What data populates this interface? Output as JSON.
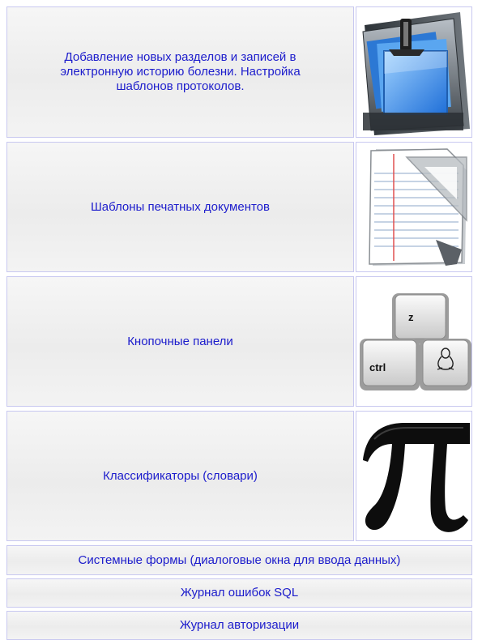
{
  "menu": {
    "items": [
      {
        "label": "Добавление новых разделов и записей в электронную историю болезни. Настройка шаблонов протоколов.",
        "icon": "folder-clip-icon"
      },
      {
        "label": "Шаблоны печатных документов",
        "icon": "document-template-icon"
      },
      {
        "label": "Кнопочные панели",
        "icon": "keyboard-keys-icon"
      },
      {
        "label": "Классификаторы (словари)",
        "icon": "pi-icon"
      },
      {
        "label": "Системные формы (диалоговые окна для ввода данных)"
      },
      {
        "label": "Журнал ошибок SQL"
      },
      {
        "label": "Журнал авторизации"
      }
    ],
    "key_labels": {
      "z": "z",
      "ctrl": "ctrl"
    },
    "colors": {
      "link": "#1c1ccc",
      "border": "#c8c8f0"
    }
  }
}
